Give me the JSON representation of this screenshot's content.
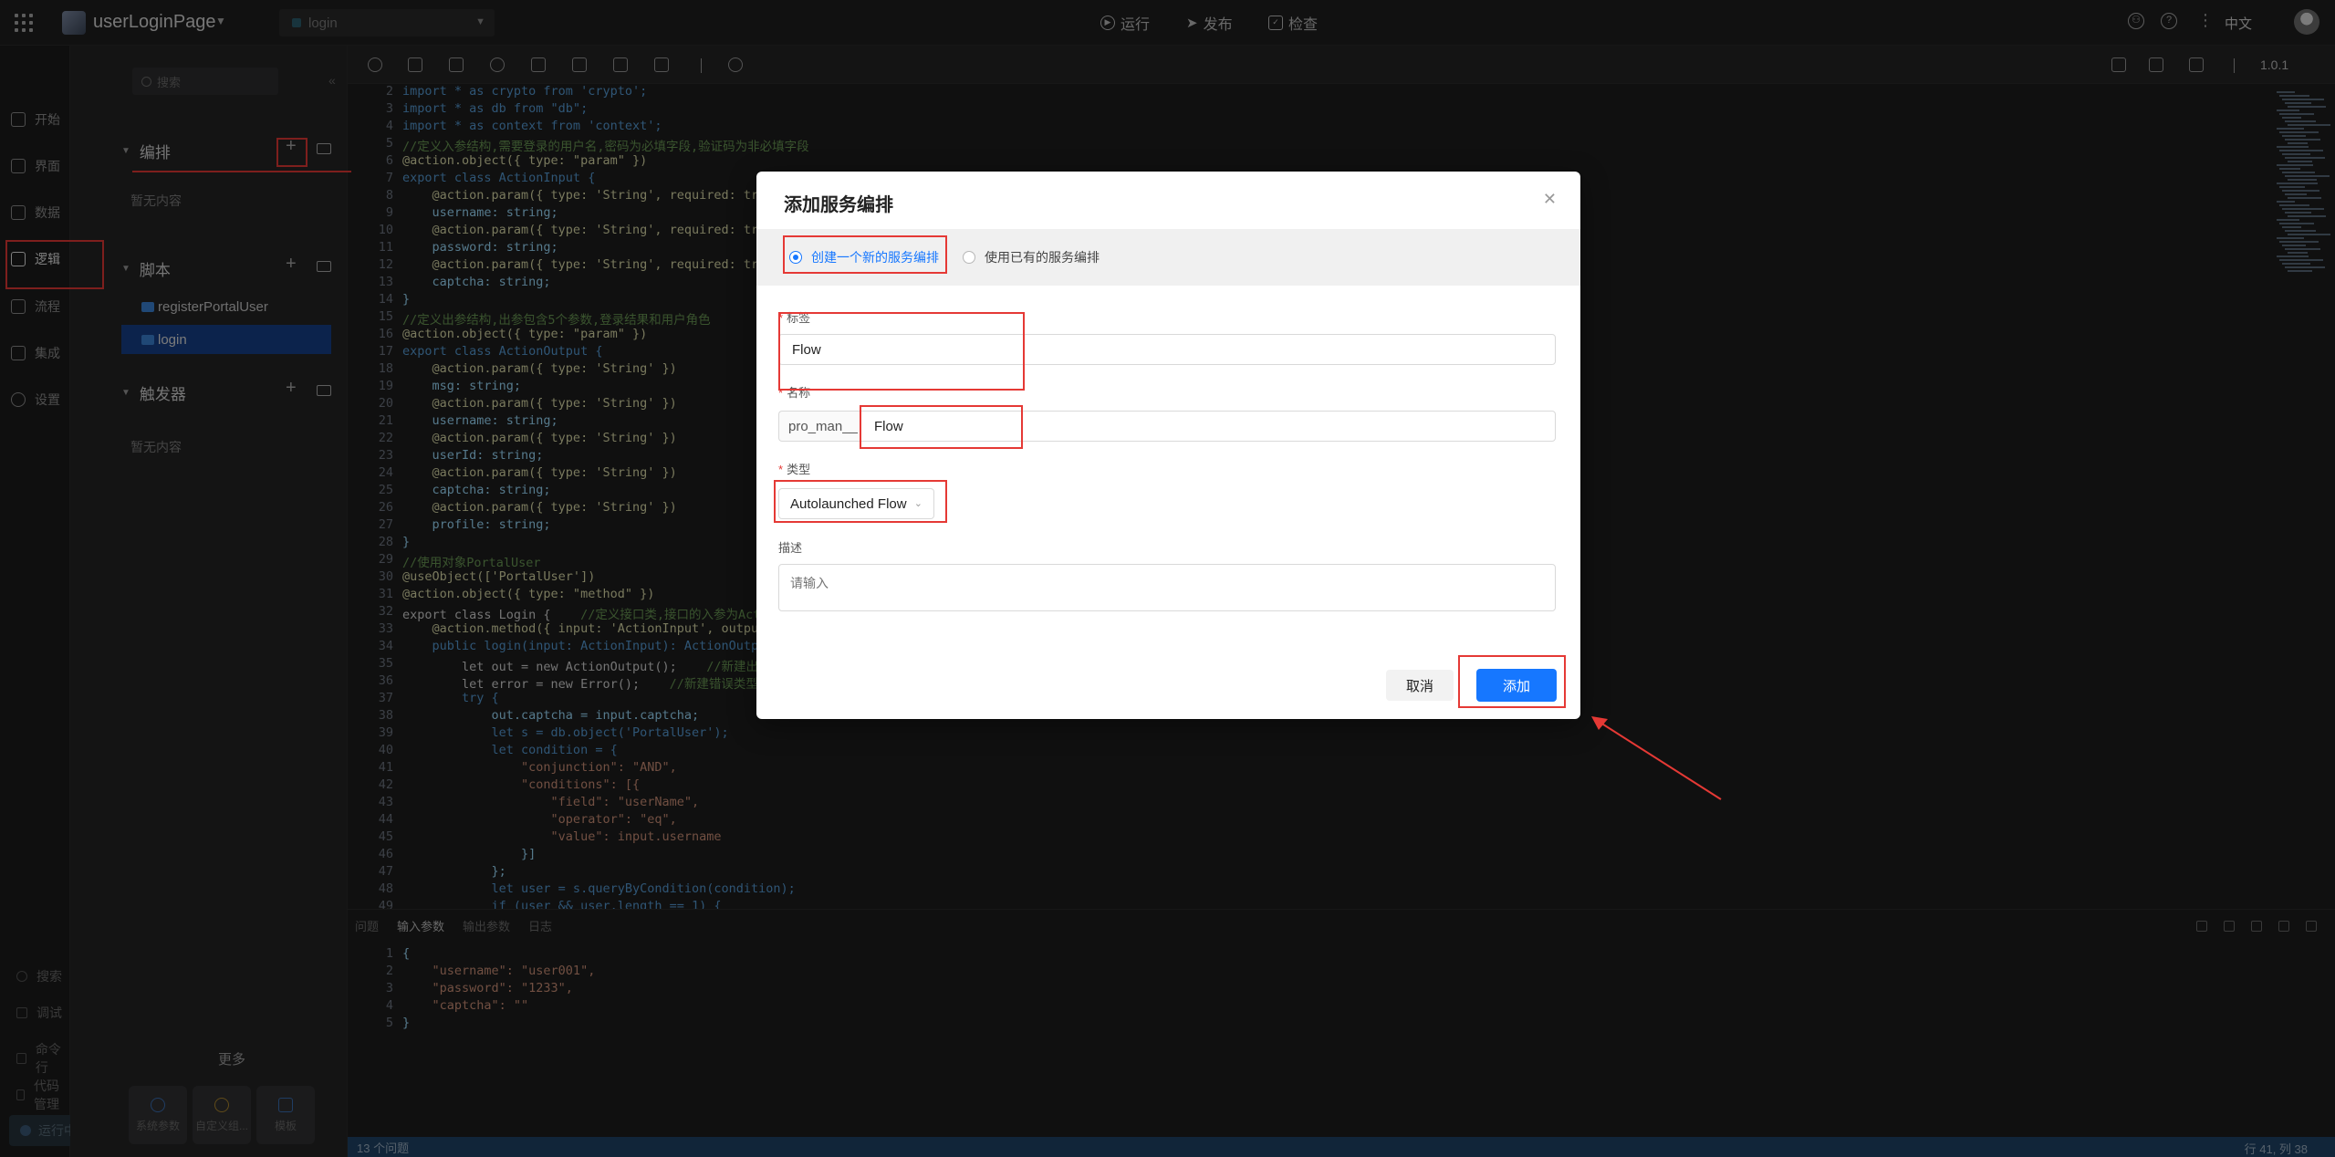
{
  "topbar": {
    "page_name": "userLoginPage",
    "page_select": "login",
    "run": "运行",
    "publish": "发布",
    "check": "检查",
    "language": "中文"
  },
  "leftnav": {
    "items": [
      "开始",
      "界面",
      "数据",
      "逻辑",
      "流程",
      "集成",
      "设置"
    ],
    "bottom": [
      "搜索",
      "调试",
      "命令行",
      "代码管理"
    ],
    "running": "运行中"
  },
  "panel": {
    "search_placeholder": "搜索",
    "orchestration_title": "编排",
    "orchestration_empty": "暂无内容",
    "scripts_title": "脚本",
    "scripts": [
      "registerPortalUser",
      "login"
    ],
    "triggers_title": "触发器",
    "triggers_empty": "暂无内容",
    "more": "更多",
    "tools": [
      "系统参数",
      "自定义组...",
      "模板"
    ]
  },
  "editor": {
    "version": "1.0.1",
    "lines": [
      {
        "n": "2",
        "t": "import * as crypto from 'crypto';"
      },
      {
        "n": "3",
        "t": "import * as db from \"db\";"
      },
      {
        "n": "4",
        "t": "import * as context from 'context';"
      },
      {
        "n": "5",
        "t": "//定义入参结构,需要登录的用户名,密码为必填字段,验证码为非必填字段"
      },
      {
        "n": "6",
        "t": "@action.object({ type: \"param\" })"
      },
      {
        "n": "7",
        "t": "export class ActionInput {"
      },
      {
        "n": "8",
        "t": "    @action.param({ type: 'String', required: true"
      },
      {
        "n": "9",
        "t": "    username: string;"
      },
      {
        "n": "10",
        "t": "    @action.param({ type: 'String', required: true"
      },
      {
        "n": "11",
        "t": "    password: string;"
      },
      {
        "n": "12",
        "t": "    @action.param({ type: 'String', required: true"
      },
      {
        "n": "13",
        "t": "    captcha: string;"
      },
      {
        "n": "14",
        "t": "}"
      },
      {
        "n": "15",
        "t": "//定义出参结构,出参包含5个参数,登录结果和用户角色"
      },
      {
        "n": "16",
        "t": "@action.object({ type: \"param\" })"
      },
      {
        "n": "17",
        "t": "export class ActionOutput {"
      },
      {
        "n": "18",
        "t": "    @action.param({ type: 'String' })"
      },
      {
        "n": "19",
        "t": "    msg: string;"
      },
      {
        "n": "20",
        "t": "    @action.param({ type: 'String' })"
      },
      {
        "n": "21",
        "t": "    username: string;"
      },
      {
        "n": "22",
        "t": "    @action.param({ type: 'String' })"
      },
      {
        "n": "23",
        "t": "    userId: string;"
      },
      {
        "n": "24",
        "t": "    @action.param({ type: 'String' })"
      },
      {
        "n": "25",
        "t": "    captcha: string;"
      },
      {
        "n": "26",
        "t": "    @action.param({ type: 'String' })"
      },
      {
        "n": "27",
        "t": "    profile: string;"
      },
      {
        "n": "28",
        "t": "}"
      },
      {
        "n": "29",
        "t": "//使用对象PortalUser"
      },
      {
        "n": "30",
        "t": "@useObject(['PortalUser'])"
      },
      {
        "n": "31",
        "t": "@action.object({ type: \"method\" })"
      },
      {
        "n": "32",
        "t": "export class Login {    //定义接口类,接口的入参为ActionInput"
      },
      {
        "n": "33",
        "t": "    @action.method({ input: 'ActionInput', output:"
      },
      {
        "n": "34",
        "t": "    public login(input: ActionInput): ActionOutput"
      },
      {
        "n": "35",
        "t": "        let out = new ActionOutput();    //新建出参"
      },
      {
        "n": "36",
        "t": "        let error = new Error();    //新建错误类型实例"
      },
      {
        "n": "37",
        "t": "        try {"
      },
      {
        "n": "38",
        "t": "            out.captcha = input.captcha;"
      },
      {
        "n": "39",
        "t": "            let s = db.object('PortalUser');"
      },
      {
        "n": "40",
        "t": "            let condition = {"
      },
      {
        "n": "41",
        "t": "                \"conjunction\": \"AND\","
      },
      {
        "n": "42",
        "t": "                \"conditions\": [{"
      },
      {
        "n": "43",
        "t": "                    \"field\": \"userName\","
      },
      {
        "n": "44",
        "t": "                    \"operator\": \"eq\","
      },
      {
        "n": "45",
        "t": "                    \"value\": input.username"
      },
      {
        "n": "46",
        "t": "                }]"
      },
      {
        "n": "47",
        "t": "            };"
      },
      {
        "n": "48",
        "t": "            let user = s.queryByCondition(condition);"
      },
      {
        "n": "49",
        "t": "            if (user && user.length == 1) {"
      }
    ]
  },
  "bottom": {
    "tabs": [
      "问题",
      "输入参数",
      "输出参数",
      "日志"
    ],
    "active_tab": "输入参数",
    "lines": [
      {
        "n": "1",
        "t": "{"
      },
      {
        "n": "2",
        "t": "    \"username\": \"user001\","
      },
      {
        "n": "3",
        "t": "    \"password\": \"1233\","
      },
      {
        "n": "4",
        "t": "    \"captcha\": \"\""
      },
      {
        "n": "5",
        "t": "}"
      }
    ]
  },
  "statusbar": {
    "problems": "13 个问题",
    "position": "行 41, 列 38"
  },
  "modal": {
    "title": "添加服务编排",
    "radio_new": "创建一个新的服务编排",
    "radio_existing": "使用已有的服务编排",
    "label_label": "标签",
    "label_value": "Flow",
    "name_label": "名称",
    "name_prefix": "pro_man__",
    "name_value": "Flow",
    "type_label": "类型",
    "type_value": "Autolaunched Flow",
    "desc_label": "描述",
    "desc_placeholder": "请输入",
    "cancel": "取消",
    "add": "添加"
  }
}
